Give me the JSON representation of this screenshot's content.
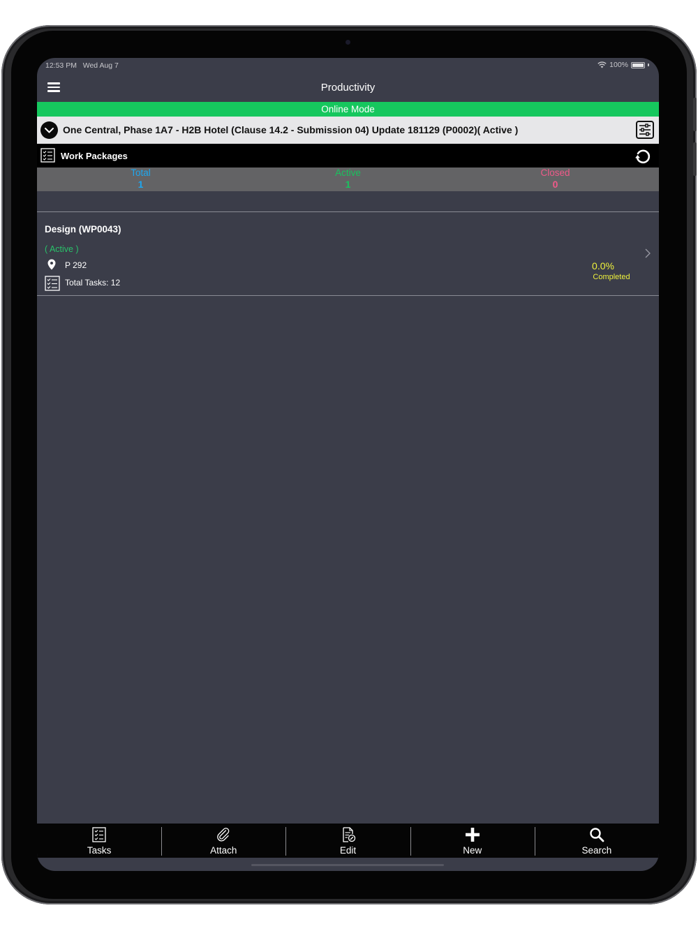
{
  "status_bar": {
    "time": "12:53 PM",
    "date": "Wed Aug 7",
    "battery": "100%"
  },
  "nav": {
    "title": "Productivity",
    "menu_icon": "hamburger-menu-icon"
  },
  "mode_banner": {
    "label": "Online Mode",
    "color": "#16c75e"
  },
  "project": {
    "title": "One Central, Phase 1A7 - H2B Hotel (Clause 14.2 - Submission 04) Update 181129 (P0002)( Active )"
  },
  "work_packages": {
    "title": "Work Packages"
  },
  "stats": [
    {
      "label": "Total",
      "value": "1",
      "color": "#1ea7ef"
    },
    {
      "label": "Active",
      "value": "1",
      "color": "#19c25e"
    },
    {
      "label": "Closed",
      "value": "0",
      "color": "#ef5a89"
    }
  ],
  "package": {
    "title": "Design (WP0043)",
    "status": "( Active )",
    "location": "P 292",
    "tasks": "Total Tasks: 12",
    "percent": "0.0%",
    "percent_label": "Completed"
  },
  "tabs": [
    {
      "label": "Tasks",
      "icon": "checklist-icon"
    },
    {
      "label": "Attach",
      "icon": "paperclip-icon"
    },
    {
      "label": "Edit",
      "icon": "edit-document-icon"
    },
    {
      "label": "New",
      "icon": "plus-icon"
    },
    {
      "label": "Search",
      "icon": "search-icon"
    }
  ]
}
